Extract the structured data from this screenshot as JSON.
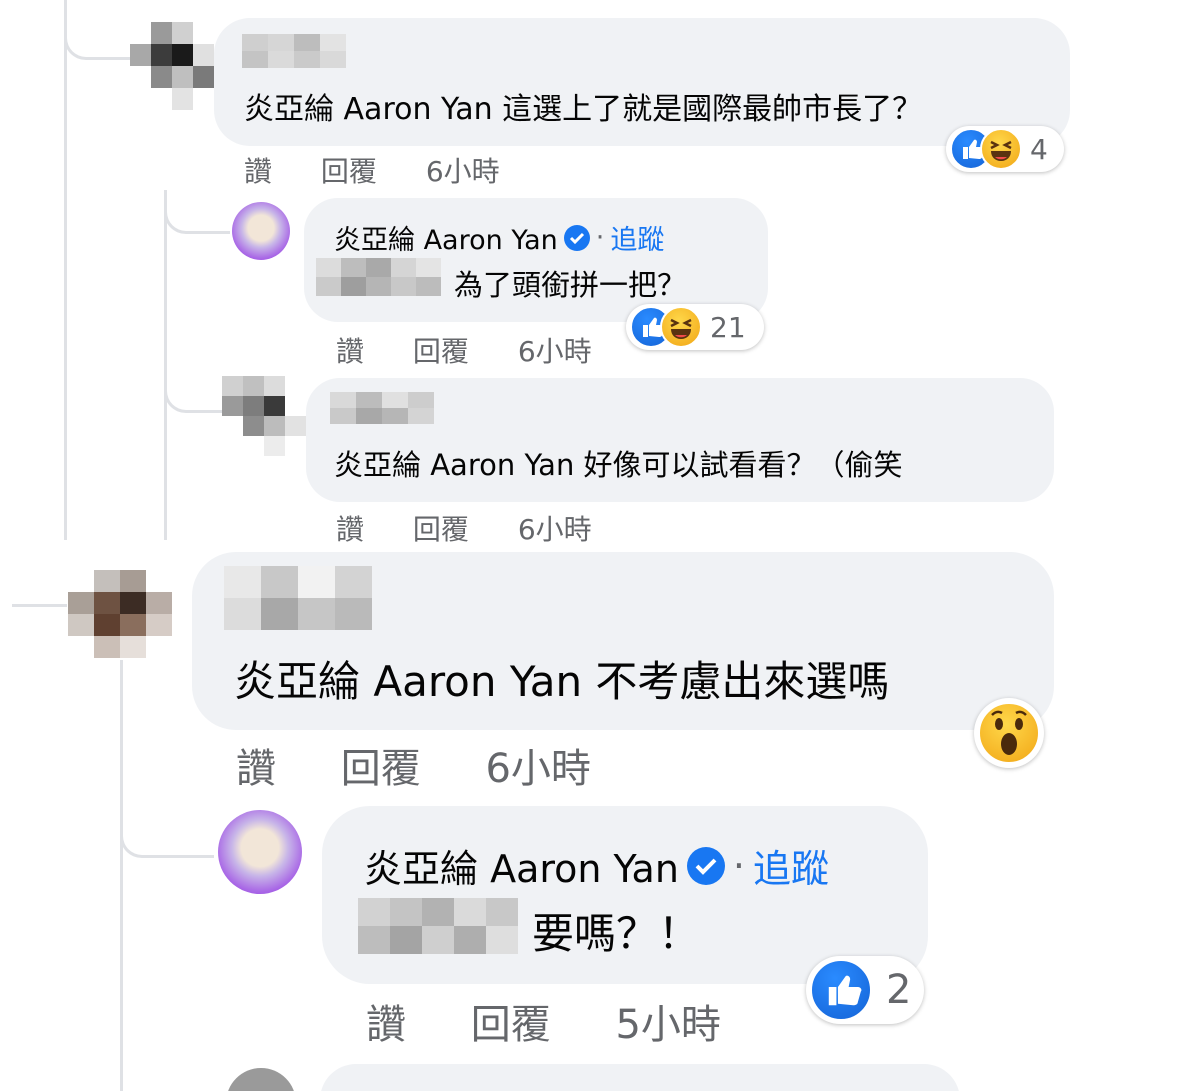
{
  "comments": [
    {
      "author": "",
      "text": "炎亞綸 Aaron Yan 這選上了就是國際最帥市長了？",
      "actions": {
        "like": "讚",
        "reply": "回覆",
        "time": "6小時"
      },
      "reactions": {
        "icons": [
          "like-icon",
          "haha-icon"
        ],
        "count": "4"
      }
    },
    {
      "author": "炎亞綸 Aaron Yan",
      "follow": "追蹤",
      "dot": "·",
      "text": "為了頭銜拼一把？",
      "actions": {
        "like": "讚",
        "reply": "回覆",
        "time": "6小時"
      },
      "reactions": {
        "icons": [
          "like-icon",
          "haha-icon"
        ],
        "count": "21"
      }
    },
    {
      "author": "",
      "text": "炎亞綸 Aaron Yan 好像可以試看看？（偷笑",
      "actions": {
        "like": "讚",
        "reply": "回覆",
        "time": "6小時"
      }
    },
    {
      "author": "",
      "text": "炎亞綸 Aaron Yan 不考慮出來選嗎",
      "actions": {
        "like": "讚",
        "reply": "回覆",
        "time": "6小時"
      },
      "reactions": {
        "icons": [
          "wow-icon"
        ]
      }
    },
    {
      "author": "炎亞綸 Aaron Yan",
      "follow": "追蹤",
      "dot": "·",
      "text": "要嗎？！",
      "actions": {
        "like": "讚",
        "reply": "回覆",
        "time": "5小時"
      },
      "reactions": {
        "icons": [
          "like-icon"
        ],
        "count": "2"
      }
    }
  ],
  "colors": {
    "bubble": "#f0f2f5",
    "link": "#1877f2",
    "meta": "#65676b",
    "thread_line": "#dfe1e5"
  }
}
